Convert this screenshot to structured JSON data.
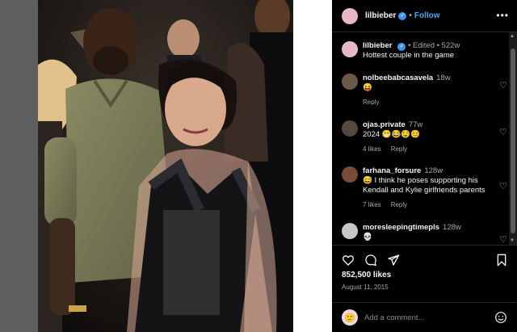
{
  "post": {
    "author": "lilbieber",
    "follow_label": "Follow",
    "edited_label": "Edited",
    "caption": "Hottest couple in the game",
    "caption_age": "522w"
  },
  "comments": [
    {
      "user": "nolbeebabcasavela",
      "age": "18w",
      "text": "😝",
      "reply": "Reply",
      "likes": "",
      "avatar_color": "#6b5a4a"
    },
    {
      "user": "ojas.private",
      "age": "77w",
      "text": "2024 😁😂🤤😊",
      "reply": "Reply",
      "likes": "4 likes",
      "avatar_color": "#55493f"
    },
    {
      "user": "farhana_forsure",
      "age": "128w",
      "text": "😅 I think he poses supporting his Kendall and Kylie girlfriends parents",
      "reply": "Reply",
      "likes": "7 likes",
      "avatar_color": "#7a4a3a"
    },
    {
      "user": "moresleepingtimepls",
      "age": "128w",
      "text": "💀",
      "reply": "",
      "likes": "",
      "avatar_color": "#c8c8c8"
    }
  ],
  "stats": {
    "likes": "852,500 likes",
    "date": "August 11, 2015"
  },
  "composer": {
    "placeholder": "Add a comment..."
  },
  "colors": {
    "panel_bg": "#000000",
    "link": "#4aa3f5",
    "verified": "#3897f0",
    "muted": "#a8a8a8"
  },
  "icons": [
    "more-icon",
    "heart-icon",
    "comment-icon",
    "share-icon",
    "bookmark-icon",
    "emoji-icon",
    "smile-icon"
  ]
}
